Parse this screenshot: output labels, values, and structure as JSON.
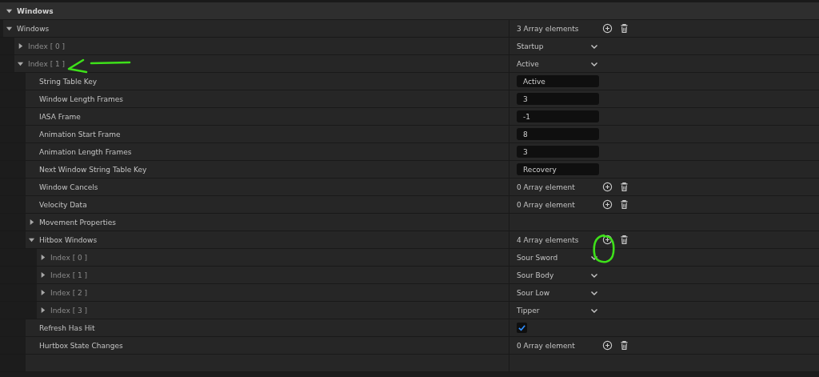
{
  "category": {
    "label": "Windows",
    "expanded": true
  },
  "rows": [
    {
      "label": "Windows",
      "kind": "property",
      "expanded": true,
      "value": {
        "kind": "array",
        "text": "3 Array elements"
      },
      "children": [
        {
          "label": "Index [ 0 ]",
          "kind": "element",
          "expanded": false,
          "value": {
            "kind": "dropdown",
            "text": "Startup"
          }
        },
        {
          "label": "Index [ 1 ]",
          "kind": "element",
          "expanded": true,
          "value": {
            "kind": "dropdown",
            "text": "Active"
          },
          "children": [
            {
              "label": "String Table Key",
              "kind": "property",
              "value": {
                "kind": "input",
                "text": "Active"
              }
            },
            {
              "label": "Window Length Frames",
              "kind": "property",
              "value": {
                "kind": "input",
                "text": "3"
              }
            },
            {
              "label": "IASA Frame",
              "kind": "property",
              "value": {
                "kind": "input",
                "text": "-1"
              }
            },
            {
              "label": "Animation Start Frame",
              "kind": "property",
              "value": {
                "kind": "input",
                "text": "8"
              }
            },
            {
              "label": "Animation Length Frames",
              "kind": "property",
              "value": {
                "kind": "input",
                "text": "3"
              }
            },
            {
              "label": "Next Window String Table Key",
              "kind": "property",
              "value": {
                "kind": "input",
                "text": "Recovery"
              }
            },
            {
              "label": "Window Cancels",
              "kind": "property",
              "value": {
                "kind": "array",
                "text": "0 Array element"
              }
            },
            {
              "label": "Velocity Data",
              "kind": "property",
              "value": {
                "kind": "array",
                "text": "0 Array element"
              }
            },
            {
              "label": "Movement Properties",
              "kind": "property",
              "expanded": false
            },
            {
              "label": "Hitbox Windows",
              "kind": "property",
              "expanded": true,
              "value": {
                "kind": "array",
                "text": "4 Array elements"
              },
              "children": [
                {
                  "label": "Index [ 0 ]",
                  "kind": "element",
                  "expanded": false,
                  "value": {
                    "kind": "dropdown",
                    "text": "Sour Sword"
                  }
                },
                {
                  "label": "Index [ 1 ]",
                  "kind": "element",
                  "expanded": false,
                  "value": {
                    "kind": "dropdown",
                    "text": "Sour Body"
                  }
                },
                {
                  "label": "Index [ 2 ]",
                  "kind": "element",
                  "expanded": false,
                  "value": {
                    "kind": "dropdown",
                    "text": "Sour Low"
                  }
                },
                {
                  "label": "Index [ 3 ]",
                  "kind": "element",
                  "expanded": false,
                  "value": {
                    "kind": "dropdown",
                    "text": "Tipper"
                  }
                }
              ]
            },
            {
              "label": "Refresh Has Hit",
              "kind": "property",
              "value": {
                "kind": "checkbox",
                "checked": true
              }
            },
            {
              "label": "Hurtbox State Changes",
              "kind": "property",
              "value": {
                "kind": "array",
                "text": "0 Array element"
              }
            }
          ]
        }
      ]
    }
  ]
}
